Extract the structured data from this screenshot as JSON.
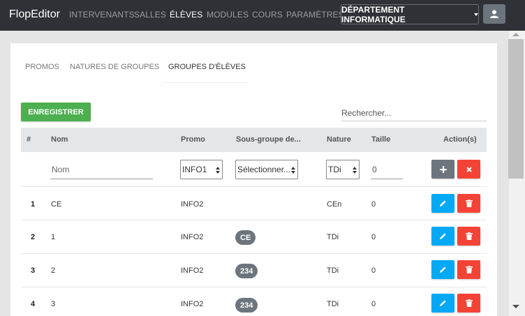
{
  "navbar": {
    "brand": "FlopEditor",
    "links": [
      "INTERVENANTS",
      "SALLES",
      "ÉLÈVES",
      "MODULES",
      "COURS",
      "PARAMÈTRES"
    ],
    "department": "DÉPARTEMENT INFORMATIQUE"
  },
  "tabs": [
    "PROMOS",
    "NATURES DE GROUPES",
    "GROUPES D'ÉLÈVES"
  ],
  "actions": {
    "save_label": "ENREGISTRER",
    "search_placeholder": "Rechercher..."
  },
  "table": {
    "headers": [
      "#",
      "Nom",
      "Promo",
      "Sous-groupe de...",
      "Nature",
      "Taille",
      "Action(s)"
    ],
    "new_row": {
      "name_placeholder": "Nom",
      "promo": "INFO1",
      "subgroup": "Sélectionner...",
      "nature": "TDi",
      "size": "0"
    },
    "rows": [
      {
        "id": "1",
        "name": "CE",
        "promo": "INFO2",
        "subgroup": "",
        "nature": "CEn",
        "size": "0"
      },
      {
        "id": "2",
        "name": "1",
        "promo": "INFO2",
        "subgroup": "CE",
        "nature": "TDi",
        "size": "0"
      },
      {
        "id": "3",
        "name": "2",
        "promo": "INFO2",
        "subgroup": "234",
        "nature": "TDi",
        "size": "0"
      },
      {
        "id": "4",
        "name": "3",
        "promo": "INFO2",
        "subgroup": "234",
        "nature": "TDi",
        "size": "0"
      }
    ]
  },
  "colors": {
    "navbar": "#2e3236",
    "save": "#4caf50",
    "edit": "#03a9f4",
    "delete": "#f44336",
    "neutral": "#6c757d"
  }
}
